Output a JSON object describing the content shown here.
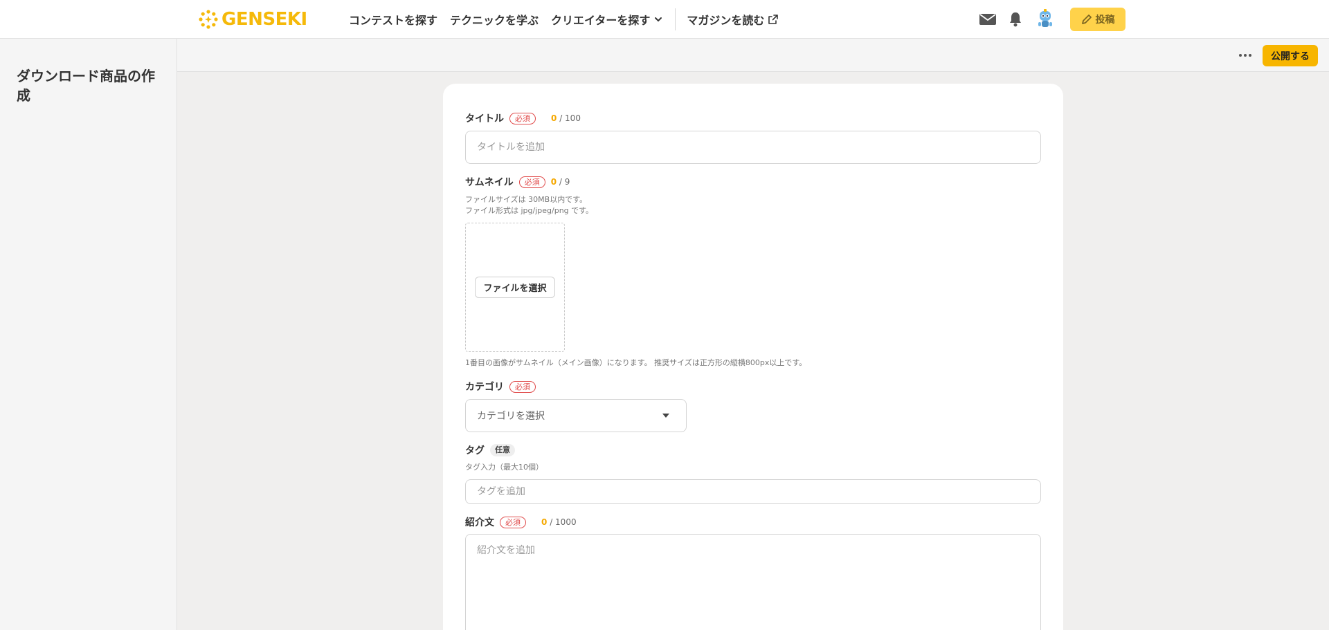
{
  "header": {
    "logo_text": "GENSEKI",
    "nav": [
      {
        "label": "コンテストを探す"
      },
      {
        "label": "テクニックを学ぶ"
      },
      {
        "label": "クリエイターを探す"
      },
      {
        "label": "マガジンを読む"
      }
    ],
    "post_label": "投稿"
  },
  "sidebar": {
    "title": "ダウンロード商品の作成"
  },
  "toolbar": {
    "publish_label": "公開する"
  },
  "form": {
    "required_badge": "必須",
    "optional_badge": "任意",
    "title": {
      "label": "タイトル",
      "count": "0",
      "max": "/ 100",
      "placeholder": "タイトルを追加",
      "value": ""
    },
    "thumbnail": {
      "label": "サムネイル",
      "count": "0",
      "max": "/ 9",
      "help_size": "ファイルサイズは 30MB以内です。",
      "help_format": "ファイル形式は jpg/jpeg/png です。",
      "file_button": "ファイルを選択",
      "note": "1番目の画像がサムネイル（メイン画像）になります。 推奨サイズは正方形の縦横800px以上です。"
    },
    "category": {
      "label": "カテゴリ",
      "selected": "カテゴリを選択"
    },
    "tags": {
      "label": "タグ",
      "help": "タグ入力（最大10個）",
      "placeholder": "タグを追加",
      "value": ""
    },
    "description": {
      "label": "紹介文",
      "count": "0",
      "max": "/ 1000",
      "placeholder": "紹介文を追加",
      "value": ""
    }
  },
  "colors": {
    "accent": "#f7b500",
    "brand": "#f5b90a",
    "required": "#e04a4a"
  }
}
